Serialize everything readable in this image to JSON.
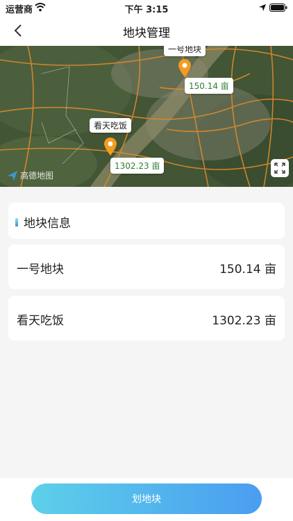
{
  "status_bar": {
    "carrier": "运营商",
    "time": "下午 3:15"
  },
  "nav": {
    "title": "地块管理"
  },
  "map": {
    "provider_logo": "高德地图",
    "markers": [
      {
        "name": "一号地块",
        "area": "150.14 亩"
      },
      {
        "name": "看天吃饭",
        "area": "1302.23 亩"
      }
    ],
    "pin_color": "#f39c1f",
    "area_text_color": "#2e7d32"
  },
  "section": {
    "title": "地块信息"
  },
  "plots": [
    {
      "name": "一号地块",
      "area": "150.14 亩"
    },
    {
      "name": "看天吃饭",
      "area": "1302.23 亩"
    }
  ],
  "actions": {
    "draw_plot_label": "划地块"
  },
  "colors": {
    "accent_gradient_start": "#5dd0ea",
    "accent_gradient_end": "#4a9df0"
  }
}
